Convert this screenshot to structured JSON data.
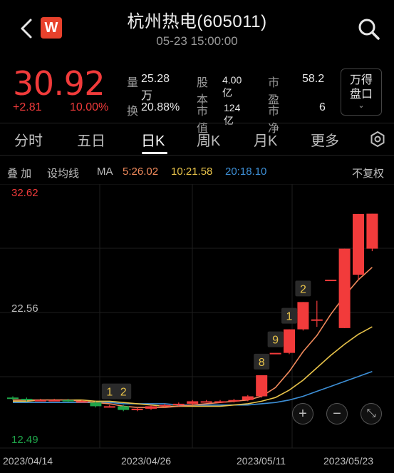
{
  "header": {
    "title": "杭州热电(605011)",
    "subtitle": "05-23 15:00:00",
    "logo_letter": "W"
  },
  "quote": {
    "price": "30.92",
    "change": "+2.81",
    "change_pct": "10.00%",
    "stats": [
      {
        "label": "量",
        "value": "25.28万"
      },
      {
        "label": "股本",
        "value": "4.00亿"
      },
      {
        "label": "市盈",
        "value": "58.2"
      },
      {
        "label": "换",
        "value": "20.88%"
      },
      {
        "label": "市值",
        "value": "124亿"
      },
      {
        "label": "市净",
        "value": "6"
      }
    ],
    "wande_button": {
      "line1": "万得",
      "line2": "盘口",
      "chevron": "⌄"
    }
  },
  "tabs": [
    "分时",
    "五日",
    "日K",
    "周K",
    "月K",
    "更多"
  ],
  "active_tab": "日K",
  "ma_row": {
    "overlay_label": "叠 加",
    "settings_label": "设均线",
    "ma_label": "MA",
    "ma5": "5:26.02",
    "ma10": "10:21.58",
    "ma20": "20:18.10",
    "adjust_label": "不复权"
  },
  "colors": {
    "up": "#f23b3b",
    "down": "#1fa64a",
    "ma5": "#f08a5c",
    "ma10": "#e8c34a",
    "ma20": "#3d8fd6"
  },
  "chart_data": {
    "type": "candlestick",
    "y_top_label": "32.62",
    "y_mid_label": "22.56",
    "y_bottom_label": "12.49",
    "ylim": [
      12.49,
      32.62
    ],
    "x_tick_labels": [
      "2023/04/14",
      "2023/04/26",
      "2023/05/11",
      "2023/05/23"
    ],
    "grid": true,
    "candles": [
      {
        "open": 16.1,
        "close": 16.0,
        "high": 16.2,
        "low": 15.9
      },
      {
        "open": 16.0,
        "close": 15.9,
        "high": 16.1,
        "low": 15.8
      },
      {
        "open": 15.9,
        "close": 15.9,
        "high": 16.0,
        "low": 15.8
      },
      {
        "open": 15.9,
        "close": 15.9,
        "high": 16.0,
        "low": 15.8
      },
      {
        "open": 15.9,
        "close": 15.8,
        "high": 16.0,
        "low": 15.7
      },
      {
        "open": 15.8,
        "close": 15.8,
        "high": 15.9,
        "low": 15.7
      },
      {
        "open": 15.7,
        "close": 15.4,
        "high": 15.8,
        "low": 15.3
      },
      {
        "open": 15.4,
        "close": 15.4,
        "high": 15.5,
        "low": 15.3
      },
      {
        "open": 15.4,
        "close": 15.1,
        "high": 15.5,
        "low": 15.0
      },
      {
        "open": 15.1,
        "close": 15.2,
        "high": 15.3,
        "low": 15.0
      },
      {
        "open": 15.2,
        "close": 15.4,
        "high": 15.5,
        "low": 15.1
      },
      {
        "open": 15.4,
        "close": 15.5,
        "high": 15.6,
        "low": 15.3
      },
      {
        "open": 15.5,
        "close": 15.6,
        "high": 15.7,
        "low": 15.4
      },
      {
        "open": 15.6,
        "close": 15.8,
        "high": 15.9,
        "low": 15.5
      },
      {
        "open": 15.8,
        "close": 15.8,
        "high": 15.9,
        "low": 15.7
      },
      {
        "open": 15.8,
        "close": 15.8,
        "high": 15.9,
        "low": 15.7
      },
      {
        "open": 15.8,
        "close": 15.9,
        "high": 16.0,
        "low": 15.7
      },
      {
        "open": 15.9,
        "close": 16.2,
        "high": 16.3,
        "low": 15.8
      },
      {
        "open": 16.2,
        "close": 17.9,
        "high": 17.9,
        "low": 16.1
      },
      {
        "open": 19.7,
        "close": 19.7,
        "high": 19.7,
        "low": 19.7
      },
      {
        "open": 19.7,
        "close": 21.6,
        "high": 21.6,
        "low": 19.6
      },
      {
        "open": 21.6,
        "close": 23.8,
        "high": 23.8,
        "low": 21.5
      },
      {
        "open": 22.4,
        "close": 22.4,
        "high": 23.9,
        "low": 21.8
      },
      {
        "open": 25.6,
        "close": 25.6,
        "high": 25.6,
        "low": 25.6
      },
      {
        "open": 21.7,
        "close": 28.1,
        "high": 28.1,
        "low": 21.7
      },
      {
        "open": 26.0,
        "close": 30.9,
        "high": 30.9,
        "low": 25.6
      },
      {
        "open": 28.1,
        "close": 30.92,
        "high": 30.92,
        "low": 27.9
      }
    ],
    "annotations": [
      {
        "candle": 7,
        "text": "1"
      },
      {
        "candle": 8,
        "text": "2"
      },
      {
        "candle": 18,
        "text": "8"
      },
      {
        "candle": 19,
        "text": "9"
      },
      {
        "candle": 20,
        "text": "1"
      },
      {
        "candle": 21,
        "text": "2"
      }
    ],
    "ma5": [
      15.9,
      15.9,
      15.9,
      15.9,
      15.9,
      15.8,
      15.7,
      15.6,
      15.4,
      15.3,
      15.3,
      15.3,
      15.4,
      15.5,
      15.6,
      15.7,
      15.8,
      15.9,
      16.2,
      16.9,
      18.2,
      19.8,
      21.1,
      22.8,
      24.3,
      25.6,
      26.6
    ],
    "ma10": [
      15.8,
      15.8,
      15.9,
      15.9,
      15.9,
      15.9,
      15.8,
      15.8,
      15.7,
      15.6,
      15.5,
      15.4,
      15.4,
      15.4,
      15.4,
      15.4,
      15.5,
      15.6,
      15.8,
      16.1,
      16.7,
      17.5,
      18.5,
      19.5,
      20.4,
      21.2,
      21.8
    ],
    "ma20": [
      15.7,
      15.7,
      15.7,
      15.7,
      15.7,
      15.7,
      15.7,
      15.7,
      15.6,
      15.6,
      15.6,
      15.6,
      15.5,
      15.5,
      15.5,
      15.5,
      15.5,
      15.5,
      15.6,
      15.7,
      15.9,
      16.2,
      16.6,
      17.0,
      17.4,
      17.8,
      18.2
    ]
  },
  "zoom_controls": {
    "zoom_in": "+",
    "zoom_out": "−",
    "fullscreen": "⤡"
  }
}
